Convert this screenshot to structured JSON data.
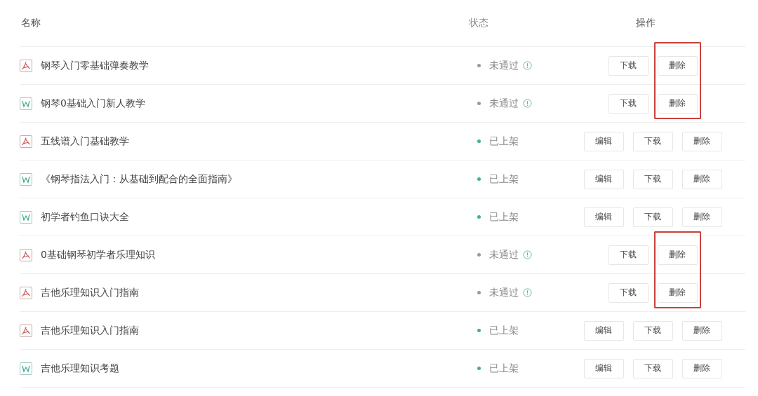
{
  "table": {
    "columns": [
      "名称",
      "状态",
      "操作"
    ],
    "rows": [
      {
        "kind": "pdf",
        "name": "钢琴入门零基础弹奏教学",
        "status": "未通过",
        "color": "#9a9a9a",
        "info": true,
        "actions": [
          "下载",
          "删除"
        ],
        "frame": {
          "kind": "start"
        }
      },
      {
        "kind": "word",
        "name": "钢琴0基础入门新人教学",
        "status": "未通过",
        "color": "#9a9a9a",
        "info": true,
        "actions": [
          "下载",
          "删除"
        ],
        "frame": {
          "kind": "end"
        }
      },
      {
        "kind": "pdf",
        "name": "五线谱入门基础教学",
        "status": "已上架",
        "color": "#3cb878",
        "info": false,
        "actions": [
          "编辑",
          "下载",
          "删除"
        ]
      },
      {
        "kind": "word",
        "name": "《钢琴指法入门：从基础到配合的全面指南》",
        "status": "已上架",
        "color": "#3cb878",
        "info": false,
        "actions": [
          "编辑",
          "下载",
          "删除"
        ]
      },
      {
        "kind": "word",
        "name": "初学者钓鱼口诀大全",
        "status": "已上架",
        "color": "#3cb878",
        "info": false,
        "actions": [
          "编辑",
          "下载",
          "删除"
        ]
      },
      {
        "kind": "pdf",
        "name": "0基础钢琴初学者乐理知识",
        "status": "未通过",
        "color": "#9a9a9a",
        "info": true,
        "actions": [
          "下载",
          "删除"
        ],
        "frame": {
          "kind": "start"
        }
      },
      {
        "kind": "pdf",
        "name": "吉他乐理知识入门指南",
        "status": "未通过",
        "color": "#9a9a9a",
        "info": true,
        "actions": [
          "下载",
          "删除"
        ],
        "frame": {
          "kind": "end"
        }
      },
      {
        "kind": "pdf",
        "name": "吉他乐理知识入门指南",
        "status": "已上架",
        "color": "#3cb878",
        "info": false,
        "actions": [
          "编辑",
          "下载",
          "删除"
        ]
      },
      {
        "kind": "word",
        "name": "吉他乐理知识考题",
        "status": "已上架",
        "color": "#3cb878",
        "info": false,
        "actions": [
          "编辑",
          "下载",
          "删除"
        ]
      }
    ]
  }
}
